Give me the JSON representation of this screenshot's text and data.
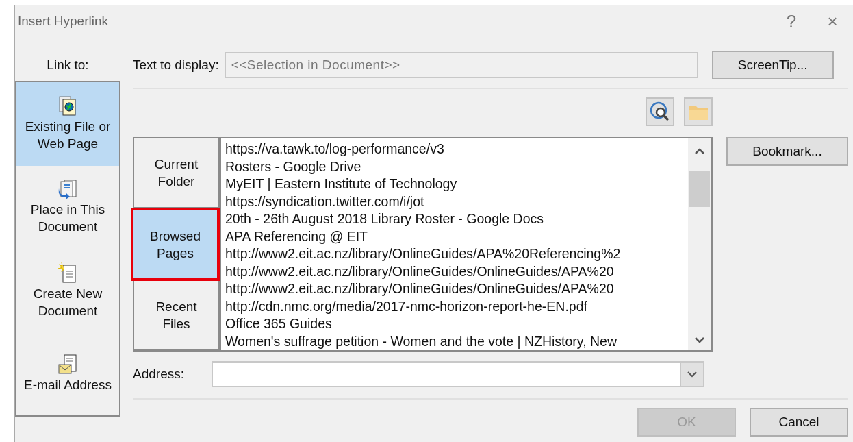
{
  "window": {
    "title": "Insert Hyperlink",
    "help": "?",
    "close": "×"
  },
  "link_to": {
    "label": "Link to:",
    "items": [
      {
        "label": "Existing File or Web Page",
        "kind": "file",
        "selected": true
      },
      {
        "label": "Place in This Document",
        "kind": "place",
        "selected": false
      },
      {
        "label": "Create New Document",
        "kind": "new",
        "selected": false
      },
      {
        "label": "E-mail Address",
        "kind": "email",
        "selected": false
      }
    ]
  },
  "text_to_display": {
    "label": "Text to display:",
    "value": "<<Selection in Document>>"
  },
  "screentip_button": "ScreenTip...",
  "look_in_tabs": [
    {
      "label": "Current Folder",
      "selected": false,
      "highlighted": false
    },
    {
      "label": "Browsed Pages",
      "selected": true,
      "highlighted": true
    },
    {
      "label": "Recent Files",
      "selected": false,
      "highlighted": false
    }
  ],
  "browsed_list": [
    "https://va.tawk.to/log-performance/v3",
    "Rosters - Google Drive",
    "MyEIT | Eastern Institute of Technology",
    "https://syndication.twitter.com/i/jot",
    "20th - 26th August 2018 Library Roster - Google Docs",
    "APA Referencing @ EIT",
    "http://www2.eit.ac.nz/library/OnlineGuides/APA%20Referencing%2",
    "http://www2.eit.ac.nz/library/OnlineGuides/OnlineGuides/APA%20",
    "http://www2.eit.ac.nz/library/OnlineGuides/OnlineGuides/APA%20",
    "http://cdn.nmc.org/media/2017-nmc-horizon-report-he-EN.pdf",
    "Office 365 Guides",
    "Women's suffrage petition - Women and the vote | NZHistory, New"
  ],
  "bookmark_button": "Bookmark...",
  "address": {
    "label": "Address:"
  },
  "buttons": [
    {
      "label": "OK",
      "disabled": true
    },
    {
      "label": "Cancel",
      "disabled": false
    }
  ]
}
